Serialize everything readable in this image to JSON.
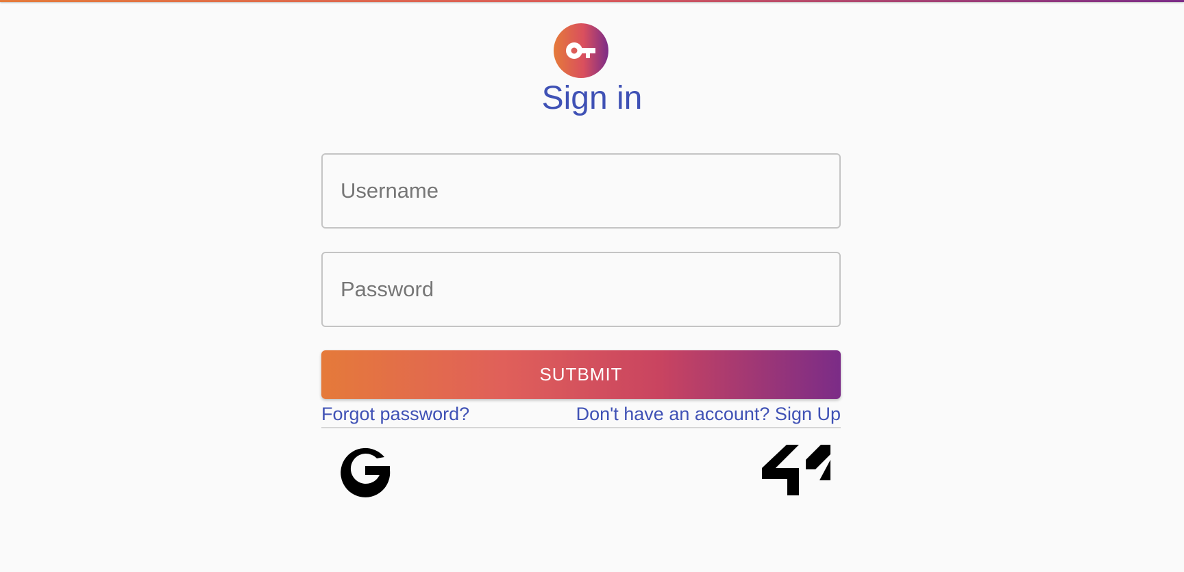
{
  "header": {
    "accent_gradient": [
      "#e57a3a",
      "#d94f5e",
      "#7b2c87"
    ],
    "logo_icon": "key-icon",
    "title": "Sign in",
    "title_color": "#3f51b5"
  },
  "form": {
    "username": {
      "placeholder": "Username",
      "value": ""
    },
    "password": {
      "placeholder": "Password",
      "value": ""
    },
    "submit_label": "SUTBMIT"
  },
  "links": {
    "forgot_password": "Forgot password?",
    "sign_up": "Don't have an account? Sign Up"
  },
  "oauth": {
    "google_icon": "google-icon",
    "fortytwo_icon": "42-icon"
  }
}
